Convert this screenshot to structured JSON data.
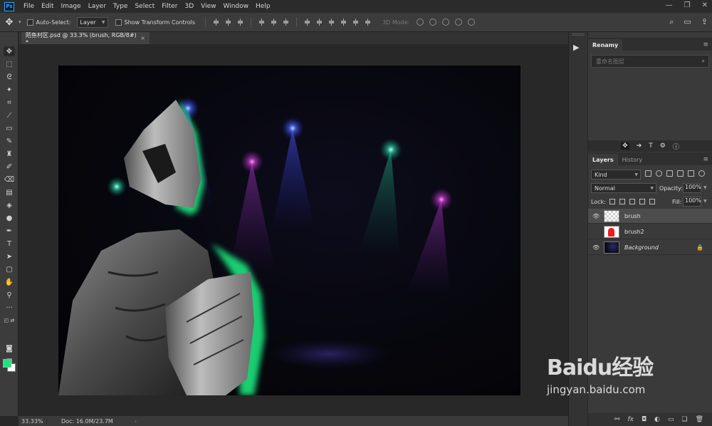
{
  "app": {
    "logo": "Ps"
  },
  "menu": [
    "File",
    "Edit",
    "Image",
    "Layer",
    "Type",
    "Select",
    "Filter",
    "3D",
    "View",
    "Window",
    "Help"
  ],
  "options": {
    "auto_select_label": "Auto-Select:",
    "auto_select_value": "Layer",
    "show_transform_label": "Show Transform Controls",
    "mode_3d_label": "3D Mode:"
  },
  "document": {
    "tab_title": "陌鱼村区.psd @ 33.3% (brush, RGB/8#) *",
    "close_glyph": "×"
  },
  "status": {
    "zoom": "33.33%",
    "doc_size": "Doc: 16.0M/23.7M"
  },
  "renamy": {
    "title": "Renamy",
    "search_placeholder": "重命名图层"
  },
  "layers_panel": {
    "tabs": [
      "Layers",
      "History"
    ],
    "kind_label": "Kind",
    "blend_mode": "Normal",
    "opacity_label": "Opacity:",
    "opacity_value": "100%",
    "lock_label": "Lock:",
    "fill_label": "Fill:",
    "fill_value": "100%",
    "layers": [
      {
        "name": "brush",
        "visible": true,
        "selected": true
      },
      {
        "name": "brush2",
        "visible": false,
        "selected": false
      },
      {
        "name": "Background",
        "visible": true,
        "selected": false,
        "locked": true
      }
    ]
  },
  "colors": {
    "foreground": "#1de37d",
    "background": "#ffffff",
    "accent": "#31a8ff"
  },
  "watermark": {
    "brand": "Baidu经验",
    "url": "jingyan.baidu.com"
  }
}
